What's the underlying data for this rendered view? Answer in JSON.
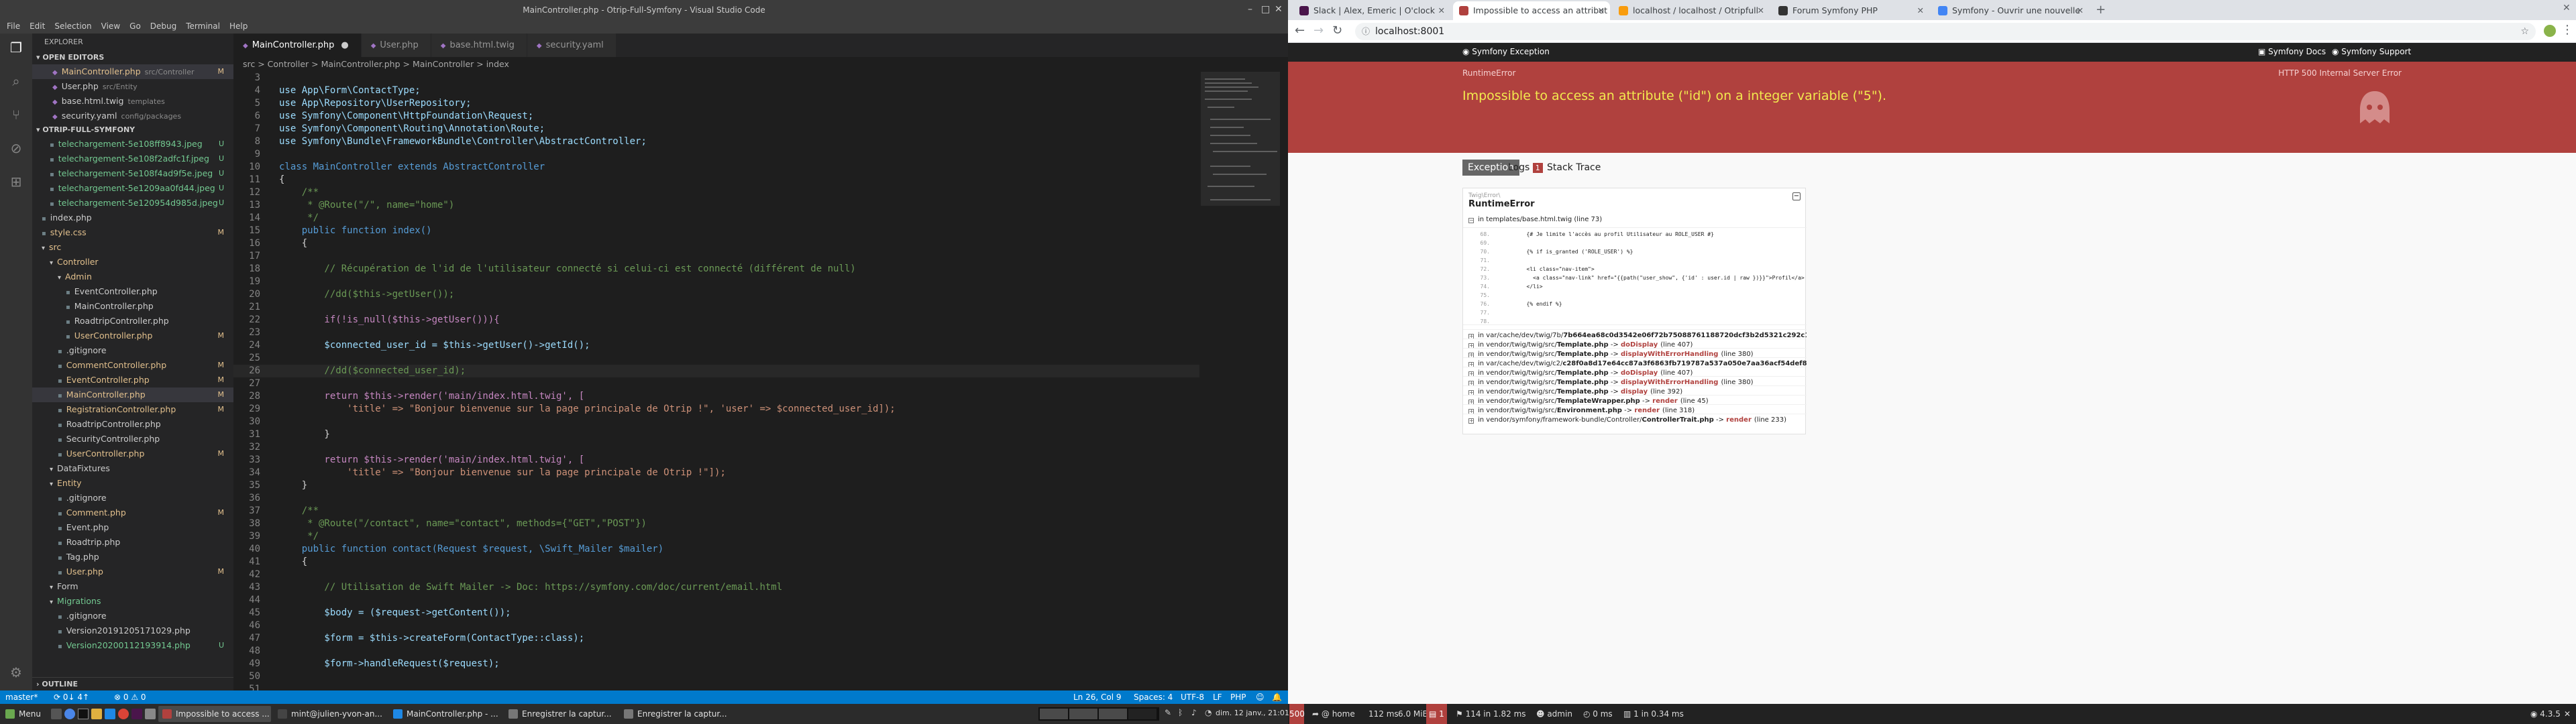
{
  "vscode": {
    "window_title": "MainController.php - Otrip-Full-Symfony - Visual Studio Code",
    "menu": [
      "File",
      "Edit",
      "Selection",
      "View",
      "Go",
      "Debug",
      "Terminal",
      "Help"
    ],
    "explorer_title": "EXPLORER",
    "open_editors_label": "OPEN EDITORS",
    "open_editors": [
      {
        "name": "MainController.php",
        "path": "src/Controller",
        "status": "M",
        "color": "mod",
        "active": true
      },
      {
        "name": "User.php",
        "path": "src/Entity",
        "status": "",
        "color": "plain"
      },
      {
        "name": "base.html.twig",
        "path": "templates",
        "status": "",
        "color": "plain"
      },
      {
        "name": "security.yaml",
        "path": "config/packages",
        "status": "",
        "color": "plain"
      }
    ],
    "project_label": "OTRIP-FULL-SYMFONY",
    "tree": [
      {
        "name": "telechargement-5e108ff8943.jpeg",
        "status": "U",
        "color": "new",
        "indent": 1
      },
      {
        "name": "telechargement-5e108f2adfc1f.jpeg",
        "status": "U",
        "color": "new",
        "indent": 1
      },
      {
        "name": "telechargement-5e108f4ad9f5e.jpeg",
        "status": "U",
        "color": "new",
        "indent": 1
      },
      {
        "name": "telechargement-5e1209aa0fd44.jpeg",
        "status": "U",
        "color": "new",
        "indent": 1
      },
      {
        "name": "telechargement-5e120954d985d.jpeg",
        "status": "U",
        "color": "new",
        "indent": 1
      },
      {
        "name": "index.php",
        "status": "",
        "color": "plain",
        "indent": 0
      },
      {
        "name": "style.css",
        "status": "M",
        "color": "mod",
        "indent": 0
      },
      {
        "name": "src",
        "status": "",
        "color": "mod",
        "indent": 0,
        "folder": true
      },
      {
        "name": "Controller",
        "status": "",
        "color": "mod",
        "indent": 1,
        "folder": true
      },
      {
        "name": "Admin",
        "status": "",
        "color": "mod",
        "indent": 2,
        "folder": true
      },
      {
        "name": "EventController.php",
        "status": "",
        "color": "plain",
        "indent": 3
      },
      {
        "name": "MainController.php",
        "status": "",
        "color": "plain",
        "indent": 3
      },
      {
        "name": "RoadtripController.php",
        "status": "",
        "color": "plain",
        "indent": 3
      },
      {
        "name": "UserController.php",
        "status": "M",
        "color": "mod",
        "indent": 3
      },
      {
        "name": ".gitignore",
        "status": "",
        "color": "plain",
        "indent": 2
      },
      {
        "name": "CommentController.php",
        "status": "M",
        "color": "mod",
        "indent": 2
      },
      {
        "name": "EventController.php",
        "status": "M",
        "color": "mod",
        "indent": 2
      },
      {
        "name": "MainController.php",
        "status": "M",
        "color": "mod",
        "indent": 2,
        "selected": true
      },
      {
        "name": "RegistrationController.php",
        "status": "M",
        "color": "mod",
        "indent": 2
      },
      {
        "name": "RoadtripController.php",
        "status": "",
        "color": "plain",
        "indent": 2
      },
      {
        "name": "SecurityController.php",
        "status": "",
        "color": "plain",
        "indent": 2
      },
      {
        "name": "UserController.php",
        "status": "M",
        "color": "mod",
        "indent": 2
      },
      {
        "name": "DataFixtures",
        "status": "",
        "color": "plain",
        "indent": 1,
        "folder": true
      },
      {
        "name": "Entity",
        "status": "",
        "color": "mod",
        "indent": 1,
        "folder": true
      },
      {
        "name": ".gitignore",
        "status": "",
        "color": "plain",
        "indent": 2
      },
      {
        "name": "Comment.php",
        "status": "M",
        "color": "mod",
        "indent": 2
      },
      {
        "name": "Event.php",
        "status": "",
        "color": "plain",
        "indent": 2
      },
      {
        "name": "Roadtrip.php",
        "status": "",
        "color": "plain",
        "indent": 2
      },
      {
        "name": "Tag.php",
        "status": "",
        "color": "plain",
        "indent": 2
      },
      {
        "name": "User.php",
        "status": "M",
        "color": "mod",
        "indent": 2
      },
      {
        "name": "Form",
        "status": "",
        "color": "plain",
        "indent": 1,
        "folder": true
      },
      {
        "name": "Migrations",
        "status": "",
        "color": "new",
        "indent": 1,
        "folder": true
      },
      {
        "name": ".gitignore",
        "status": "",
        "color": "plain",
        "indent": 2
      },
      {
        "name": "Version20191205171029.php",
        "status": "",
        "color": "plain",
        "indent": 2
      },
      {
        "name": "Version20200112193914.php",
        "status": "U",
        "color": "new",
        "indent": 2
      }
    ],
    "outline_label": "OUTLINE",
    "tabs": [
      {
        "label": "MainController.php",
        "ext": "php",
        "active": true,
        "dirty": true
      },
      {
        "label": "User.php",
        "ext": "php"
      },
      {
        "label": "base.html.twig",
        "ext": "twig"
      },
      {
        "label": "security.yaml",
        "ext": "yml"
      }
    ],
    "breadcrumb": "src > Controller > MainController.php > MainController > index",
    "code": [
      {
        "n": "3",
        "t": ""
      },
      {
        "n": "4",
        "t": "use App\\Form\\ContactType;"
      },
      {
        "n": "5",
        "t": "use App\\Repository\\UserRepository;"
      },
      {
        "n": "6",
        "t": "use Symfony\\Component\\HttpFoundation\\Request;"
      },
      {
        "n": "7",
        "t": "use Symfony\\Component\\Routing\\Annotation\\Route;"
      },
      {
        "n": "8",
        "t": "use Symfony\\Bundle\\FrameworkBundle\\Controller\\AbstractController;"
      },
      {
        "n": "9",
        "t": ""
      },
      {
        "n": "10",
        "t": "class MainController extends AbstractController"
      },
      {
        "n": "11",
        "t": "{"
      },
      {
        "n": "12",
        "t": "    /**"
      },
      {
        "n": "13",
        "t": "     * @Route(\"/\", name=\"home\")"
      },
      {
        "n": "14",
        "t": "     */"
      },
      {
        "n": "15",
        "t": "    public function index()"
      },
      {
        "n": "16",
        "t": "    {"
      },
      {
        "n": "17",
        "t": ""
      },
      {
        "n": "18",
        "t": "        // Récupération de l'id de l'utilisateur connecté si celui-ci est connecté (différent de null)"
      },
      {
        "n": "19",
        "t": ""
      },
      {
        "n": "20",
        "t": "        //dd($this->getUser());"
      },
      {
        "n": "21",
        "t": ""
      },
      {
        "n": "22",
        "t": "        if(!is_null($this->getUser())){"
      },
      {
        "n": "23",
        "t": ""
      },
      {
        "n": "24",
        "t": "        $connected_user_id = $this->getUser()->getId();"
      },
      {
        "n": "25",
        "t": ""
      },
      {
        "n": "26",
        "t": "        //dd($connected_user_id);"
      },
      {
        "n": "27",
        "t": ""
      },
      {
        "n": "28",
        "t": "        return $this->render('main/index.html.twig', ["
      },
      {
        "n": "29",
        "t": "            'title' => \"Bonjour bienvenue sur la page principale de Otrip !\", 'user' => $connected_user_id]);"
      },
      {
        "n": "30",
        "t": ""
      },
      {
        "n": "31",
        "t": "        }"
      },
      {
        "n": "32",
        "t": ""
      },
      {
        "n": "33",
        "t": "        return $this->render('main/index.html.twig', ["
      },
      {
        "n": "34",
        "t": "            'title' => \"Bonjour bienvenue sur la page principale de Otrip !\"]);"
      },
      {
        "n": "35",
        "t": "    }"
      },
      {
        "n": "36",
        "t": ""
      },
      {
        "n": "37",
        "t": "    /**"
      },
      {
        "n": "38",
        "t": "     * @Route(\"/contact\", name=\"contact\", methods={\"GET\",\"POST\"})"
      },
      {
        "n": "39",
        "t": "     */"
      },
      {
        "n": "40",
        "t": "    public function contact(Request $request, \\Swift_Mailer $mailer)"
      },
      {
        "n": "41",
        "t": "    {"
      },
      {
        "n": "42",
        "t": ""
      },
      {
        "n": "43",
        "t": "        // Utilisation de Swift Mailer -> Doc: https://symfony.com/doc/current/email.html"
      },
      {
        "n": "44",
        "t": ""
      },
      {
        "n": "45",
        "t": "        $body = ($request->getContent());"
      },
      {
        "n": "46",
        "t": ""
      },
      {
        "n": "47",
        "t": "        $form = $this->createForm(ContactType::class);"
      },
      {
        "n": "48",
        "t": ""
      },
      {
        "n": "49",
        "t": "        $form->handleRequest($request);"
      },
      {
        "n": "50",
        "t": ""
      },
      {
        "n": "51",
        "t": ""
      }
    ],
    "status": {
      "branch": "master*",
      "sync": "⟳ 0↓ 4↑",
      "problems": "⊗ 0 ⚠ 0",
      "position": "Ln 26, Col 9",
      "spaces": "Spaces: 4",
      "encoding": "UTF-8",
      "eol": "LF",
      "lang": "PHP"
    }
  },
  "browser": {
    "tabs": [
      {
        "label": "Slack | Alex, Emeric | O'clock",
        "color": "#4a154b"
      },
      {
        "label": "Impossible to access an attribut",
        "color": "#b0413e",
        "active": true
      },
      {
        "label": "localhost / localhost / Otripfull",
        "color": "#f89c0e"
      },
      {
        "label": "Forum Symfony PHP",
        "color": "#333333"
      },
      {
        "label": "Symfony - Ouvrir une nouvelle",
        "color": "#4285f4"
      }
    ],
    "url": "localhost:8001",
    "sf": {
      "brand": "Symfony Exception",
      "docs": "Symfony Docs",
      "support": "Symfony Support",
      "error_class": "RuntimeError",
      "http_status": "HTTP 500 Internal Server Error",
      "message": "Impossible to access an attribute (\"id\") on a integer variable (\"5\").",
      "tabs": {
        "exception": "Exception",
        "logs": "Logs",
        "logs_count": "1",
        "trace": "Stack Trace"
      },
      "exc_ns": "Twig\\Error\\",
      "exc_name": "RuntimeError",
      "first_frame": "in templates/base.html.twig (line 73)",
      "source": [
        {
          "n": "68.",
          "t": "        {# Je limite l'accès au profil Utilisateur au ROLE_USER #}"
        },
        {
          "n": "69.",
          "t": ""
        },
        {
          "n": "70.",
          "t": "        {% if is_granted ('ROLE_USER') %}"
        },
        {
          "n": "71.",
          "t": ""
        },
        {
          "n": "72.",
          "t": "        <li class=\"nav-item\">"
        },
        {
          "n": "73.",
          "t": "          <a class=\"nav-link\" href=\"{{path(\"user_show\", {'id' : user.id | raw })}}\">Profil</a>"
        },
        {
          "n": "74.",
          "t": "        </li>"
        },
        {
          "n": "75.",
          "t": ""
        },
        {
          "n": "76.",
          "t": "        {% endif %}"
        },
        {
          "n": "77.",
          "t": ""
        },
        {
          "n": "78.",
          "t": ""
        }
      ],
      "frames": [
        {
          "path": "in var/cache/dev/twig/7b/",
          "file": "7b664ea68c0d3542e06f72b75088761188720dcf3b2d5321c292c1ff2bea1242.php",
          "fn": "twig_get_attribute",
          "line": "(line 179)"
        },
        {
          "path": "in vendor/twig/twig/src/",
          "file": "Template.php",
          "fn": "doDisplay",
          "line": "(line 407)"
        },
        {
          "path": "in vendor/twig/twig/src/",
          "file": "Template.php",
          "fn": "displayWithErrorHandling",
          "line": "(line 380)"
        },
        {
          "path": "in var/cache/dev/twig/c2/",
          "file": "c28f0a8d17e64cc87a3f6863fb719787a537a050e7aa36acf54def8cbe552ab9.php",
          "fn": "display",
          "line": "(line 49)"
        },
        {
          "path": "in vendor/twig/twig/src/",
          "file": "Template.php",
          "fn": "doDisplay",
          "line": "(line 407)"
        },
        {
          "path": "in vendor/twig/twig/src/",
          "file": "Template.php",
          "fn": "displayWithErrorHandling",
          "line": "(line 380)"
        },
        {
          "path": "in vendor/twig/twig/src/",
          "file": "Template.php",
          "fn": "display",
          "line": "(line 392)"
        },
        {
          "path": "in vendor/twig/twig/src/",
          "file": "TemplateWrapper.php",
          "fn": "render",
          "line": "(line 45)"
        },
        {
          "path": "in vendor/twig/twig/src/",
          "file": "Environment.php",
          "fn": "render",
          "line": "(line 318)"
        },
        {
          "path": "in vendor/symfony/framework-bundle/Controller/",
          "file": "ControllerTrait.php",
          "fn": "render",
          "line": "(line 233)"
        }
      ],
      "toolbar": {
        "status": "500",
        "route": "home",
        "time": "112 ms",
        "mem": "6.0 MiB",
        "errors": "1",
        "twig": "114 in 1.82 ms",
        "user": "admin",
        "time2": "0 ms",
        "db": "1 in 0.34 ms",
        "version": "4.3.5"
      }
    }
  },
  "taskbar": {
    "menu": "Menu",
    "windows": [
      {
        "label": "Impossible to access ...",
        "color": "#b0413e"
      },
      {
        "label": "mint@julien-yvon-an...",
        "color": "#444444"
      },
      {
        "label": "MainController.php - ...",
        "color": "#1e88e5"
      },
      {
        "label": "Enregistrer la captur...",
        "color": "#777777"
      },
      {
        "label": "Enregistrer la captur...",
        "color": "#777777"
      }
    ],
    "clock": "dim. 12 janv., 21:01"
  }
}
